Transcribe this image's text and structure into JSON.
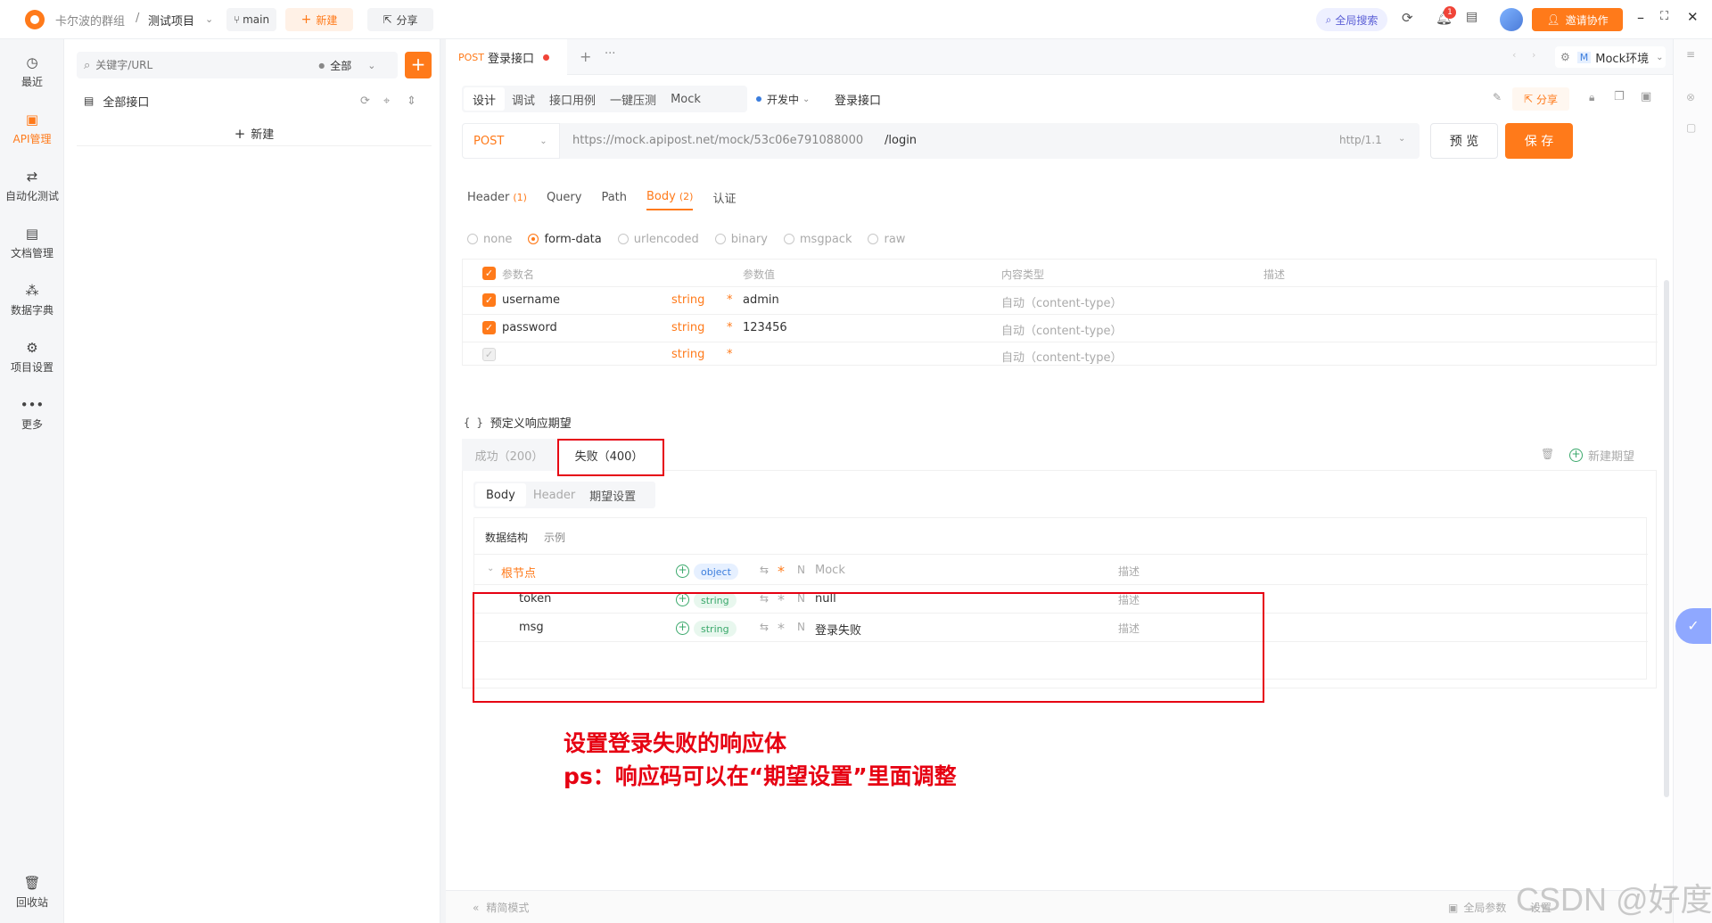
{
  "topbar": {
    "team": "卡尔波的群组",
    "sep": "/",
    "project": "测试项目",
    "branch": "main",
    "new_label": "新建",
    "share_label": "分享",
    "global_search": "全局搜索",
    "notify_count": "1",
    "invite_label": "邀请协作"
  },
  "leftnav": {
    "items": [
      {
        "label": "最近",
        "icon": "clock-icon"
      },
      {
        "label": "API管理",
        "icon": "api-icon"
      },
      {
        "label": "自动化测试",
        "icon": "automation-icon"
      },
      {
        "label": "文档管理",
        "icon": "document-icon"
      },
      {
        "label": "数据字典",
        "icon": "dictionary-icon"
      },
      {
        "label": "项目设置",
        "icon": "settings-icon"
      },
      {
        "label": "更多",
        "icon": "more-icon"
      }
    ],
    "trash_label": "回收站"
  },
  "tree": {
    "search_placeholder": "关键字/URL",
    "filter_label": "全部",
    "all_interfaces": "全部接口",
    "new_label": "新建"
  },
  "tabbar": {
    "method": "POST",
    "name": "登录接口",
    "env_prefix": "M",
    "env_label": "Mock环境"
  },
  "subtabs": {
    "items": [
      "设计",
      "调试",
      "接口用例",
      "一键压测",
      "Mock"
    ],
    "status": "开发中",
    "interface_name": "登录接口",
    "share_label": "分享"
  },
  "request": {
    "method": "POST",
    "base_url": "https://mock.apipost.net/mock/53c06e791088000",
    "path": "/login",
    "protocol": "http/1.1",
    "preview_label": "预 览",
    "save_label": "保 存"
  },
  "param_tabs": {
    "header": "Header",
    "header_count": "(1)",
    "query": "Query",
    "path": "Path",
    "body": "Body",
    "body_count": "(2)",
    "auth": "认证"
  },
  "body_modes": [
    "none",
    "form-data",
    "urlencoded",
    "binary",
    "msgpack",
    "raw"
  ],
  "params_table": {
    "headers": [
      "参数名",
      "参数值",
      "内容类型",
      "描述"
    ],
    "rows": [
      {
        "name": "username",
        "type": "string",
        "value": "admin",
        "content_type": "自动（content-type）"
      },
      {
        "name": "password",
        "type": "string",
        "value": "123456",
        "content_type": "自动（content-type）"
      },
      {
        "name": "",
        "type": "string",
        "value": "",
        "content_type": "自动（content-type）"
      }
    ]
  },
  "expect": {
    "section_title": "预定义响应期望",
    "tab_success": "成功（200）",
    "tab_fail": "失败（400）",
    "new_label": "新建期望",
    "inner_tabs": [
      "Body",
      "Header",
      "期望设置"
    ],
    "struct_tabs": [
      "数据结构",
      "示例"
    ],
    "tree": {
      "root": {
        "name": "根节点",
        "type": "object",
        "mock": "Mock",
        "desc": "描述"
      },
      "rows": [
        {
          "name": "token",
          "type": "string",
          "mock": "null",
          "desc": "描述"
        },
        {
          "name": "msg",
          "type": "string",
          "mock": "登录失败",
          "desc": "描述"
        }
      ],
      "n_label": "N"
    }
  },
  "annotation": {
    "line1": "设置登录失败的响应体",
    "line2": "ps：响应码可以在“期望设置”里面调整"
  },
  "footer": {
    "simple_mode": "精简模式",
    "global_params": "全局参数",
    "settings": "设置"
  },
  "watermark": "CSDN @好度",
  "colors": {
    "accent": "#ff7a1a",
    "annotation_red": "#e60012",
    "green": "#3aa86b"
  }
}
